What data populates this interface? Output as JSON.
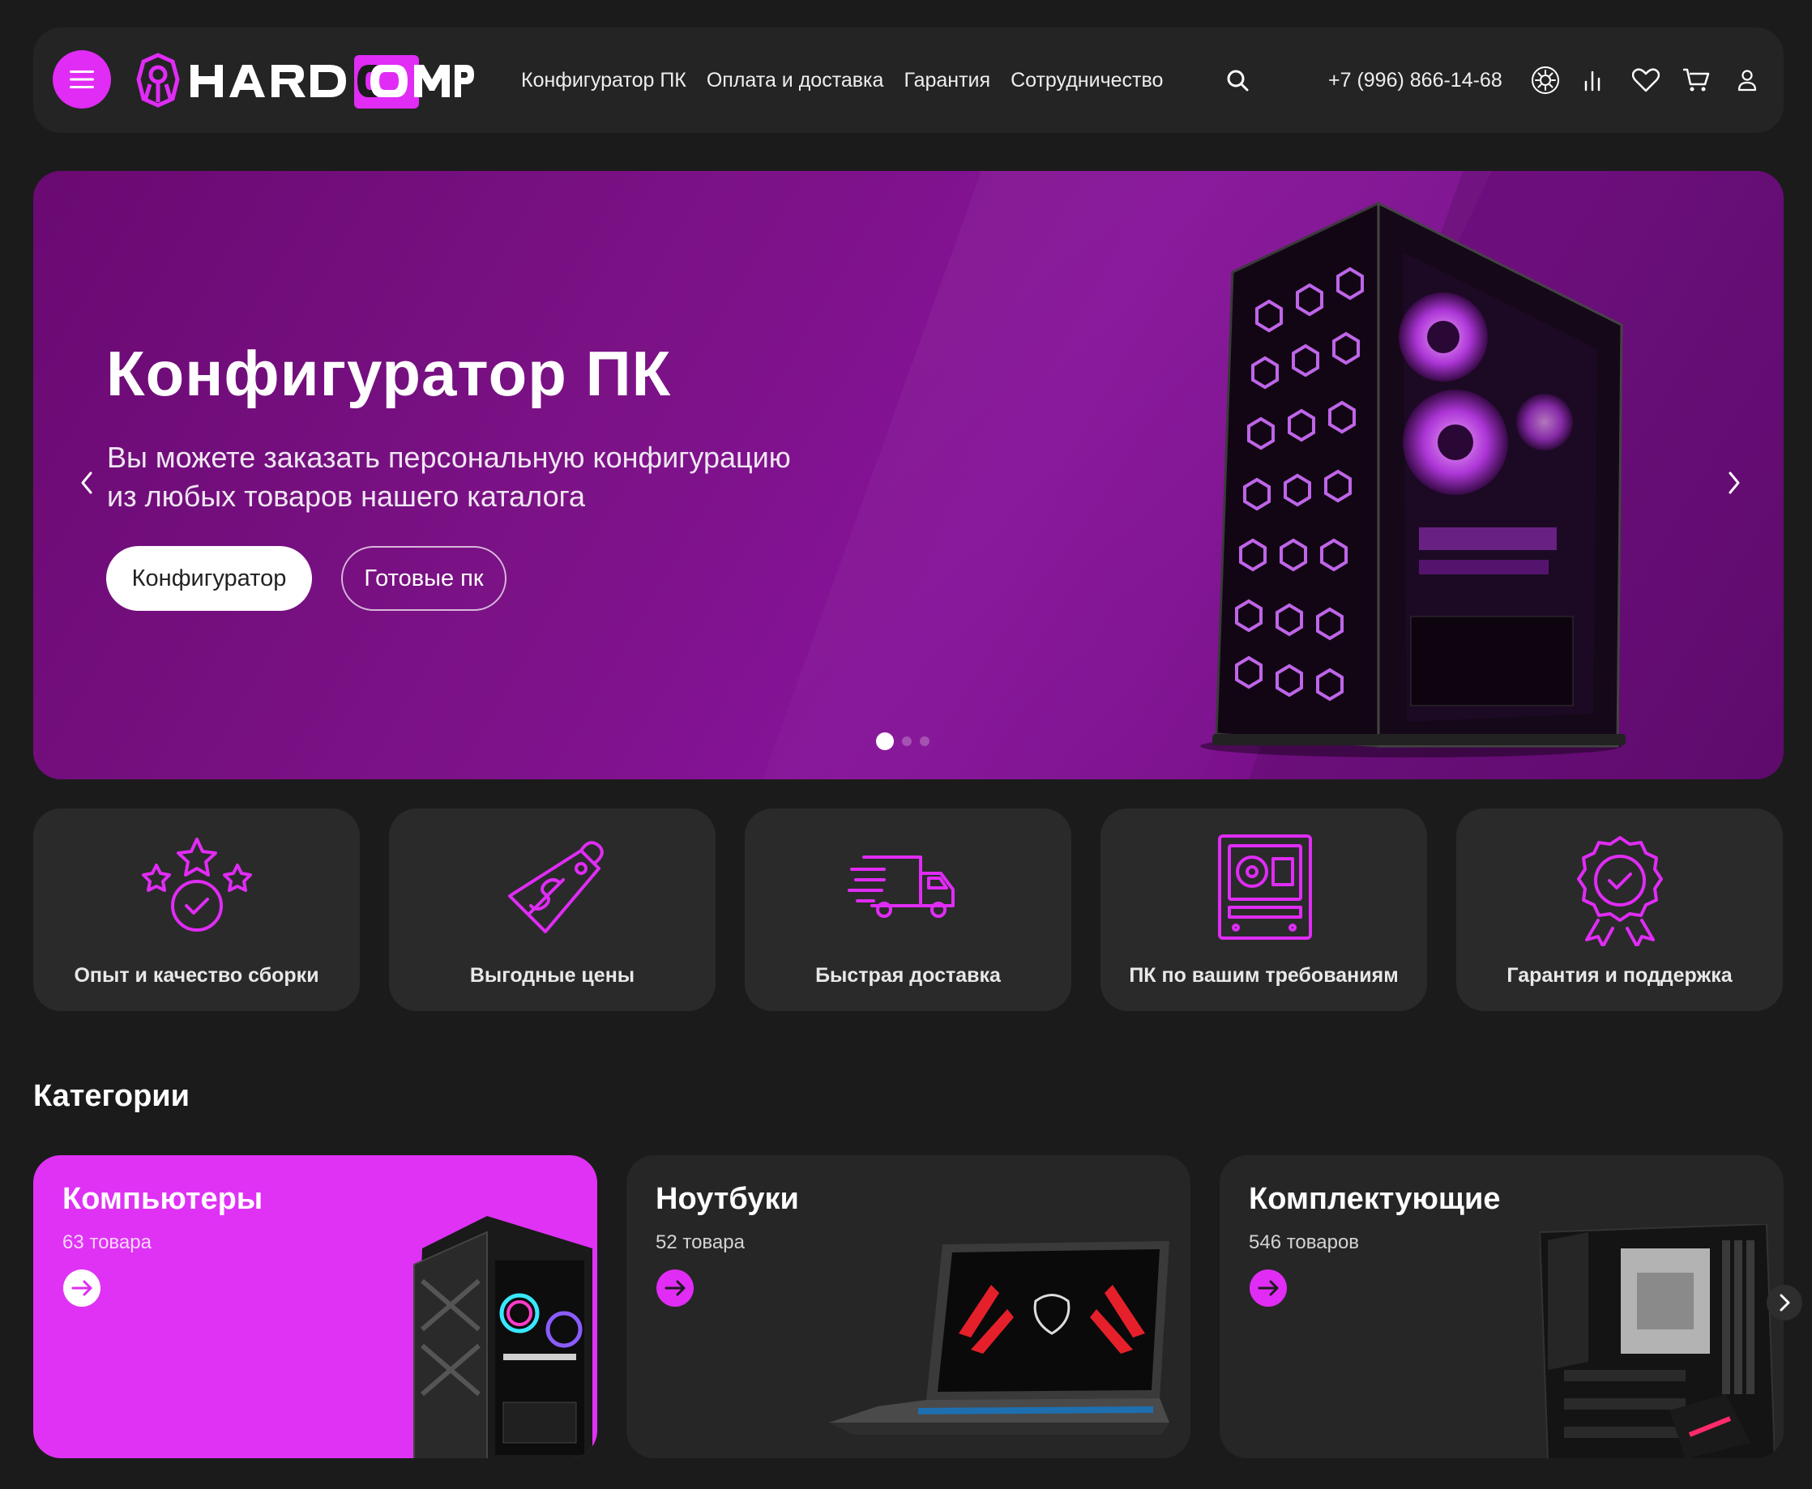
{
  "header": {
    "logo_text": "HARDCOMP",
    "nav": [
      "Конфигуратор ПК",
      "Оплата и доставка",
      "Гарантия",
      "Сотрудничество"
    ],
    "phone": "+7 (996) 866-14-68",
    "icons": [
      "menu-icon",
      "search-icon",
      "theme-icon",
      "compare-icon",
      "heart-icon",
      "cart-icon",
      "user-icon"
    ]
  },
  "hero": {
    "title": "Конфигуратор ПК",
    "subtitle_line1": "Вы можете заказать персональную конфигурацию",
    "subtitle_line2": "из любых товаров нашего каталога",
    "btn_primary": "Конфигуратор",
    "btn_secondary": "Готовые пк",
    "slides_total": 3,
    "active_slide": 1
  },
  "features": [
    {
      "label": "Опыт и качество сборки",
      "icon": "stars-check-icon"
    },
    {
      "label": "Выгодные цены",
      "icon": "price-tag-icon"
    },
    {
      "label": "Быстрая доставка",
      "icon": "truck-icon"
    },
    {
      "label": "ПК по вашим требованиям",
      "icon": "pc-case-icon"
    },
    {
      "label": "Гарантия и поддержка",
      "icon": "badge-check-icon"
    }
  ],
  "categories": {
    "title": "Категории",
    "items": [
      {
        "name": "Компьютеры",
        "count": "63 товара"
      },
      {
        "name": "Ноутбуки",
        "count": "52 товара"
      },
      {
        "name": "Комплектующие",
        "count": "546 товаров"
      }
    ]
  },
  "colors": {
    "accent": "#e02cf5",
    "background": "#1b1b1b",
    "card": "#2a2a2a"
  }
}
